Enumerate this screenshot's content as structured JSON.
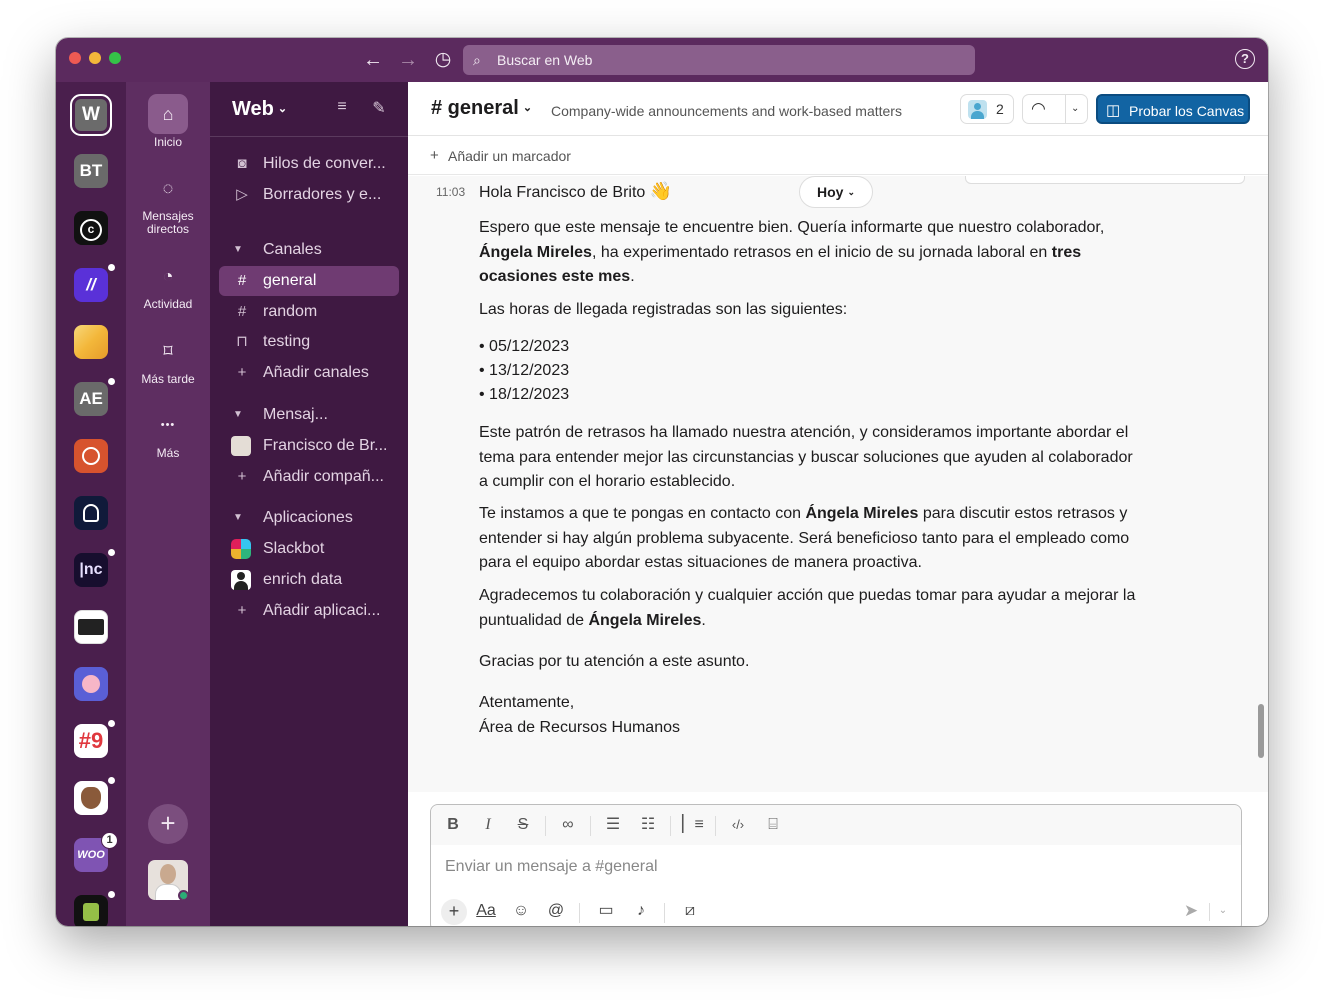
{
  "titlebar": {
    "back_icon": "arrow-left-icon",
    "forward_icon": "arrow-right-icon",
    "history_icon": "clock-icon",
    "search_placeholder": "Buscar en Web",
    "help_label": "?"
  },
  "workspaces": [
    {
      "label": "W",
      "color": "#6b6b6b"
    },
    {
      "label": "BT",
      "color": "#6a6a6a"
    },
    {
      "label": "",
      "color": "#111111"
    },
    {
      "label": "",
      "color": "#5a31d8"
    },
    {
      "label": "",
      "color": "#f7c948"
    },
    {
      "label": "AE",
      "color": "#6a6a6a"
    },
    {
      "label": "",
      "color": "#d7532e"
    },
    {
      "label": "",
      "color": "#101a3a"
    },
    {
      "label": "",
      "color": "#170e2e"
    },
    {
      "label": "",
      "color": "#ffffff"
    },
    {
      "label": "",
      "color": "#5a5fd6"
    },
    {
      "label": "",
      "color": "#ffffff"
    },
    {
      "label": "",
      "color": "#ffffff"
    },
    {
      "label": "",
      "color": "#7f54b3",
      "badge": "1"
    },
    {
      "label": "",
      "color": "#111111"
    }
  ],
  "nav": {
    "home": "Inicio",
    "dms": "Mensajes directos",
    "activity": "Actividad",
    "later": "Más tarde",
    "more": "Más",
    "more_glyph": "•••",
    "add_glyph": "+"
  },
  "sidebar": {
    "workspace_name": "Web",
    "items_top": [
      {
        "label": "Hilos de conver...",
        "icon": "thread-icon"
      },
      {
        "label": "Borradores y e...",
        "icon": "send-icon"
      }
    ],
    "channels_header": "Canales",
    "channels": [
      {
        "label": "general",
        "icon": "hash-icon",
        "active": true
      },
      {
        "label": "random",
        "icon": "hash-icon"
      },
      {
        "label": "testing",
        "icon": "lock-icon"
      },
      {
        "label": "Añadir canales",
        "icon": "plus-icon"
      }
    ],
    "dms_header": "Mensaj...",
    "dms": [
      {
        "label": "Francisco de Br...",
        "icon": "avatar-icon"
      },
      {
        "label": "Añadir compañ...",
        "icon": "plus-icon"
      }
    ],
    "apps_header": "Aplicaciones",
    "apps": [
      {
        "label": "Slackbot",
        "icon": "slackbot-icon"
      },
      {
        "label": "enrich data",
        "icon": "user-icon"
      },
      {
        "label": "Añadir aplicaci...",
        "icon": "plus-icon"
      }
    ]
  },
  "channel": {
    "name": "# general",
    "topic": "Company-wide announcements and work-based matters",
    "member_count": "2",
    "canvas_button": "Probar los Canvas",
    "add_bookmark": "Añadir un marcador"
  },
  "message": {
    "time": "11:03",
    "greeting": "Hola Francisco de Brito",
    "wave": "👋",
    "date_pill": "Hoy",
    "p1_a": "Espero que este mensaje te encuentre bien. Quería informarte que nuestro colaborador, ",
    "p1_b": "Ángela Mireles",
    "p1_c": ", ha experimentado retrasos en el inicio de su jornada laboral en ",
    "p1_d": "tres ocasiones este mes",
    "p1_e": ".",
    "p2": "Las horas de llegada registradas son las siguientes:",
    "dates": [
      "•  05/12/2023",
      "• 13/12/2023",
      "• 18/12/2023"
    ],
    "p3": "Este patrón de retrasos ha llamado nuestra atención, y consideramos importante abordar el tema para entender mejor las circunstancias y buscar soluciones que ayuden al colaborador a cumplir con el horario establecido.",
    "p4_a": "Te instamos a que te pongas en contacto con ",
    "p4_b": "Ángela Mireles",
    "p4_c": " para discutir estos retrasos y entender si hay algún problema subyacente. Será beneficioso tanto para el empleado como para el equipo abordar estas situaciones de manera proactiva.",
    "p5_a": "Agradecemos tu colaboración y cualquier acción que puedas tomar para ayudar a mejorar la puntualidad de ",
    "p5_b": "Ángela Mireles",
    "p5_c": ".",
    "p6": "Gracias por tu atención a este asunto.",
    "sign1": "Atentamente,",
    "sign2": "Área de Recursos Humanos"
  },
  "composer": {
    "placeholder": "Enviar un mensaje a #general",
    "format_bold": "B",
    "format_italic": "I",
    "format_strike": "S",
    "text_format_label": "Aa"
  }
}
